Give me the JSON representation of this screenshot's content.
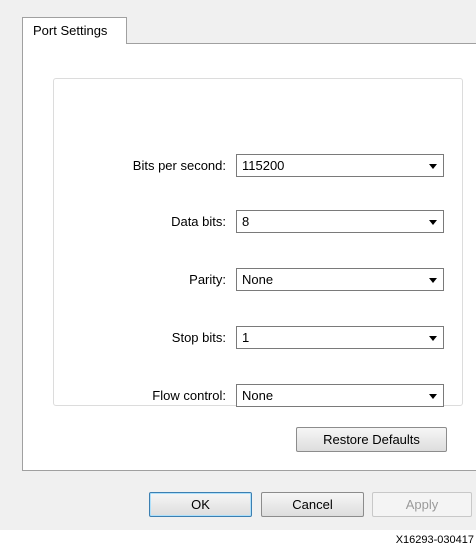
{
  "tabs": [
    {
      "label": "Port Settings",
      "active": true
    }
  ],
  "settings": [
    {
      "label": "Bits per second:",
      "value": "115200"
    },
    {
      "label": "Data bits:",
      "value": "8"
    },
    {
      "label": "Parity:",
      "value": "None"
    },
    {
      "label": "Stop bits:",
      "value": "1"
    },
    {
      "label": "Flow control:",
      "value": "None"
    }
  ],
  "buttons": {
    "restore_defaults": "Restore Defaults",
    "ok": "OK",
    "cancel": "Cancel",
    "apply": "Apply"
  },
  "figure_id": "X16293-030417"
}
